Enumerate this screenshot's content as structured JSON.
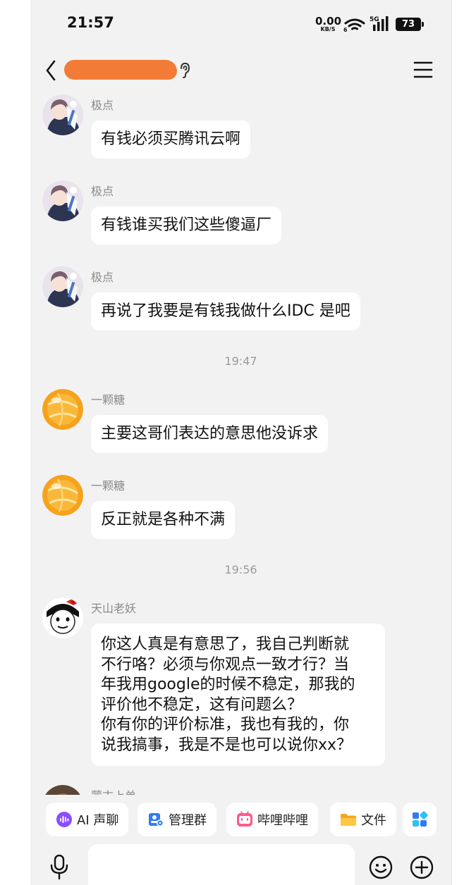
{
  "status_bar": {
    "time": "21:57",
    "net_speed_value": "0.00",
    "net_speed_unit": "KB/S",
    "network_type": "5G",
    "battery": "73"
  },
  "header": {
    "title": "",
    "title_redacted": true,
    "redaction_color": "#f27b35"
  },
  "messages": [
    {
      "type": "message",
      "sender": "极点",
      "avatar": "anime-avatar",
      "text": "有钱必须买腾讯云啊"
    },
    {
      "type": "message",
      "sender": "极点",
      "avatar": "anime-avatar",
      "text": "有钱谁买我们这些傻逼厂"
    },
    {
      "type": "message",
      "sender": "极点",
      "avatar": "anime-avatar",
      "text": "再说了我要是有钱我做什么IDC 是吧"
    },
    {
      "type": "time",
      "text": "19:47"
    },
    {
      "type": "message",
      "sender": "一颗糖",
      "avatar": "orange-ball-avatar",
      "text": "主要这哥们表达的意思他没诉求"
    },
    {
      "type": "message",
      "sender": "一颗糖",
      "avatar": "orange-ball-avatar",
      "text": "反正就是各种不满"
    },
    {
      "type": "time",
      "text": "19:56"
    },
    {
      "type": "message",
      "sender": "天山老妖",
      "avatar": "cartoon-bow-avatar",
      "lines": [
        "你这人真是有意思了，我自己判断就",
        "不行咯？必须与你观点一致才行？当",
        "年我用google的时候不稳定，那我的",
        "评价他不稳定，这有问题么？",
        "你有你的评价标准，我也有我的，你",
        "说我搞事，我是不是也可以说你xx？"
      ]
    },
    {
      "type": "message",
      "sender": "蒙古上单",
      "avatar": "brown-avatar",
      "partial": true
    }
  ],
  "quick_actions": [
    {
      "label": "AI 声聊",
      "icon": "ai-voice-icon"
    },
    {
      "label": "管理群",
      "icon": "group-manage-icon"
    },
    {
      "label": "哔哩哔哩",
      "icon": "bilibili-icon"
    },
    {
      "label": "文件",
      "icon": "folder-icon"
    },
    {
      "label": "",
      "icon": "apps-grid-icon"
    }
  ],
  "input": {
    "value": "",
    "placeholder": ""
  },
  "colors": {
    "page_background": "#f2f2f2",
    "bubble_background": "#ffffff",
    "sender_name": "#8a8a8a",
    "timestamp": "#9a9a9a"
  }
}
